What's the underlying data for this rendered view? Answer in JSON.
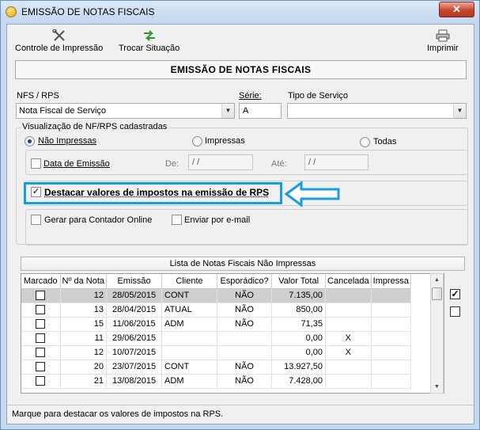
{
  "window": {
    "title": "EMISSÃO DE NOTAS FISCAIS",
    "close_glyph": "✕"
  },
  "toolbar": {
    "controle_label": "Controle de Impressão",
    "trocar_label": "Trocar Situação",
    "imprimir_label": "Imprimir"
  },
  "header": {
    "title": "EMISSÃO DE NOTAS FISCAIS"
  },
  "form": {
    "nfs_label": "NFS / RPS",
    "nfs_value": "Nota Fiscal de Serviço",
    "serie_label": "Série:",
    "serie_value": "A",
    "tipo_label": "Tipo de Serviço",
    "tipo_value": ""
  },
  "visualizacao": {
    "group_title": "Visualização de NF/RPS cadastradas",
    "opt_nao_impressas": "Não Impressas",
    "opt_impressas": "Impressas",
    "opt_todas": "Todas",
    "selected": "Não Impressas",
    "data_emissao_label": "Data de Emissão",
    "de_label": "De:",
    "de_value": "/ /",
    "ate_label": "Até:",
    "ate_value": "/ /"
  },
  "options": {
    "destacar_label": "Destacar valores de impostos na emissão de RPS",
    "destacar_checked": true,
    "gerar_label": "Gerar para Contador Online",
    "enviar_label": "Enviar por e-mail"
  },
  "list": {
    "title": "Lista de Notas Fiscais Não Impressas",
    "columns": [
      "Marcado",
      "Nº da Nota",
      "Emissão",
      "Cliente",
      "Esporádico?",
      "Valor Total",
      "Cancelada",
      "Impressa"
    ],
    "rows": [
      [
        "",
        "12",
        "28/05/2015",
        "CONT",
        "NÃO",
        "7.135,00",
        "",
        ""
      ],
      [
        "",
        "13",
        "28/04/2015",
        "ATUAL",
        "NÃO",
        "850,00",
        "",
        ""
      ],
      [
        "",
        "15",
        "11/06/2015",
        "ADM",
        "NÃO",
        "71,35",
        "",
        ""
      ],
      [
        "",
        "11",
        "29/06/2015",
        "",
        "",
        "0,00",
        "X",
        ""
      ],
      [
        "",
        "12",
        "10/07/2015",
        "",
        "",
        "0,00",
        "X",
        ""
      ],
      [
        "",
        "20",
        "23/07/2015",
        "CONT",
        "NÃO",
        "13.927,50",
        "",
        ""
      ],
      [
        "",
        "21",
        "13/08/2015",
        "ADM",
        "NÃO",
        "7.428,00",
        "",
        ""
      ]
    ],
    "selected_row": 0
  },
  "side": {
    "check_all_glyph": "✓"
  },
  "status": {
    "text": "Marque para destacar os valores de impostos na RPS."
  },
  "colors": {
    "highlight": "#1a9ce0",
    "selected_row": "#cfcfcf"
  }
}
